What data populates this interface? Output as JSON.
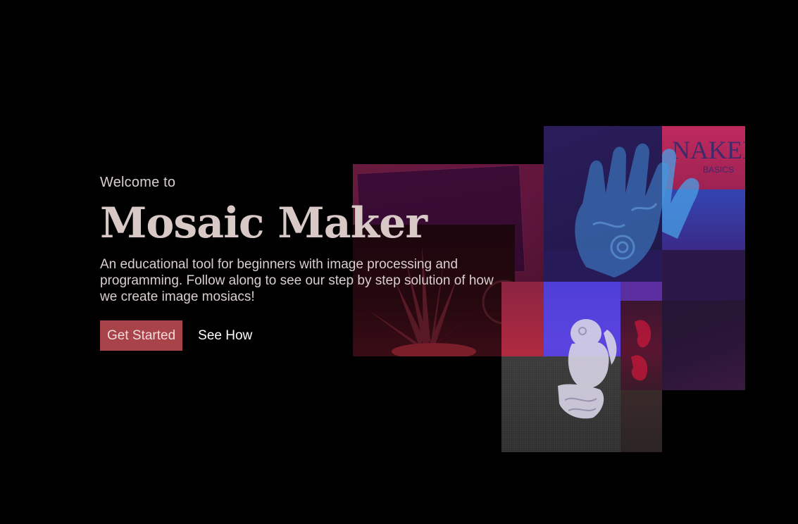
{
  "hero": {
    "welcome": "Welcome to",
    "title": "Mosaic Maker",
    "description": "An educational tool for beginners with image processing and programming. Follow along to see our step by step solution of how we create image mosiacs!",
    "primary_button": "Get Started",
    "secondary_link": "See How"
  },
  "mosaic": {
    "notebook_label": "NAKED",
    "notebook_sublabel": "BASICS"
  },
  "colors": {
    "background": "#000000",
    "accent": "#a8434a",
    "title": "#d8c9c7"
  }
}
